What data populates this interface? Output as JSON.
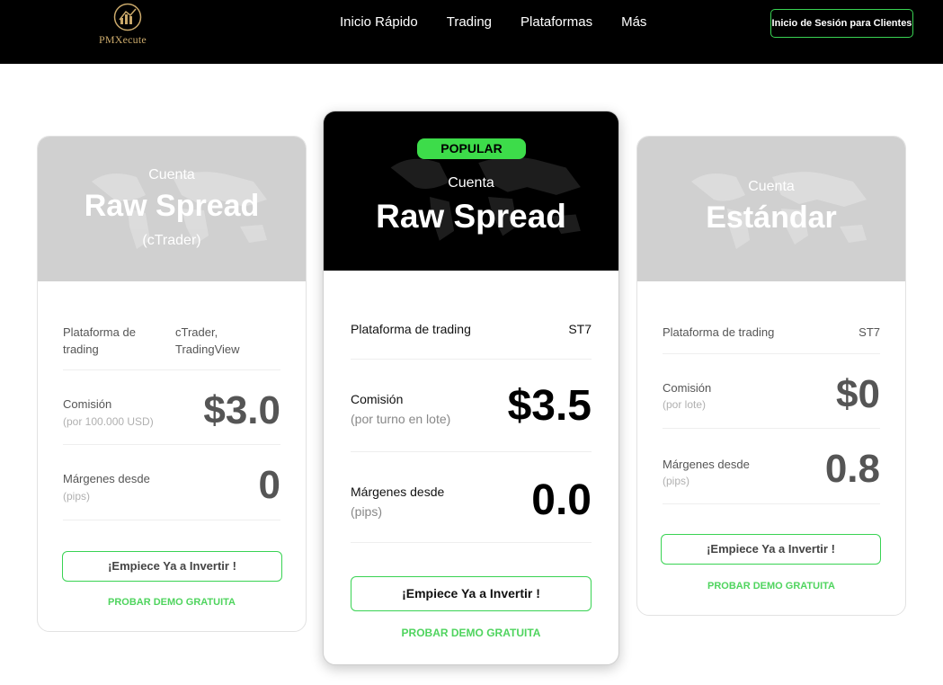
{
  "header": {
    "logo_text": "PMXecute",
    "nav": [
      "Inicio Rápido",
      "Trading",
      "Plataformas",
      "Más"
    ],
    "login_label": "Inicio de Sesión para Clientes"
  },
  "colors": {
    "accent": "#39d353",
    "header_bg": "#000000",
    "card_head_grey": "#d0d0d0"
  },
  "cards": [
    {
      "head_small": "Cuenta",
      "head_big": "Raw Spread",
      "head_sub": "(cTrader)",
      "platform_label": "Plataforma de trading",
      "platform_value": "cTrader, TradingView",
      "commission_label": "Comisión",
      "commission_sub": "(por 100.000 USD)",
      "commission_value": "$3.0",
      "spread_label": "Márgenes desde",
      "spread_sub": "(pips)",
      "spread_value": "0",
      "cta_label": "¡Empiece Ya a Invertir !",
      "demo_label": "PROBAR DEMO GRATUITA"
    },
    {
      "badge": "POPULAR",
      "head_small": "Cuenta",
      "head_big": "Raw Spread",
      "platform_label": "Plataforma de trading",
      "platform_value": "ST7",
      "commission_label": "Comisión",
      "commission_sub": "(por turno en lote)",
      "commission_value": "$3.5",
      "spread_label": "Márgenes desde",
      "spread_sub": "(pips)",
      "spread_value": "0.0",
      "cta_label": "¡Empiece Ya a Invertir !",
      "demo_label": "PROBAR DEMO GRATUITA"
    },
    {
      "head_small": "Cuenta",
      "head_big": "Estándar",
      "platform_label": "Plataforma de trading",
      "platform_value": "ST7",
      "commission_label": "Comisión",
      "commission_sub": "(por lote)",
      "commission_value": "$0",
      "spread_label": "Márgenes desde",
      "spread_sub": "(pips)",
      "spread_value": "0.8",
      "cta_label": "¡Empiece Ya a Invertir !",
      "demo_label": "PROBAR DEMO GRATUITA"
    }
  ]
}
